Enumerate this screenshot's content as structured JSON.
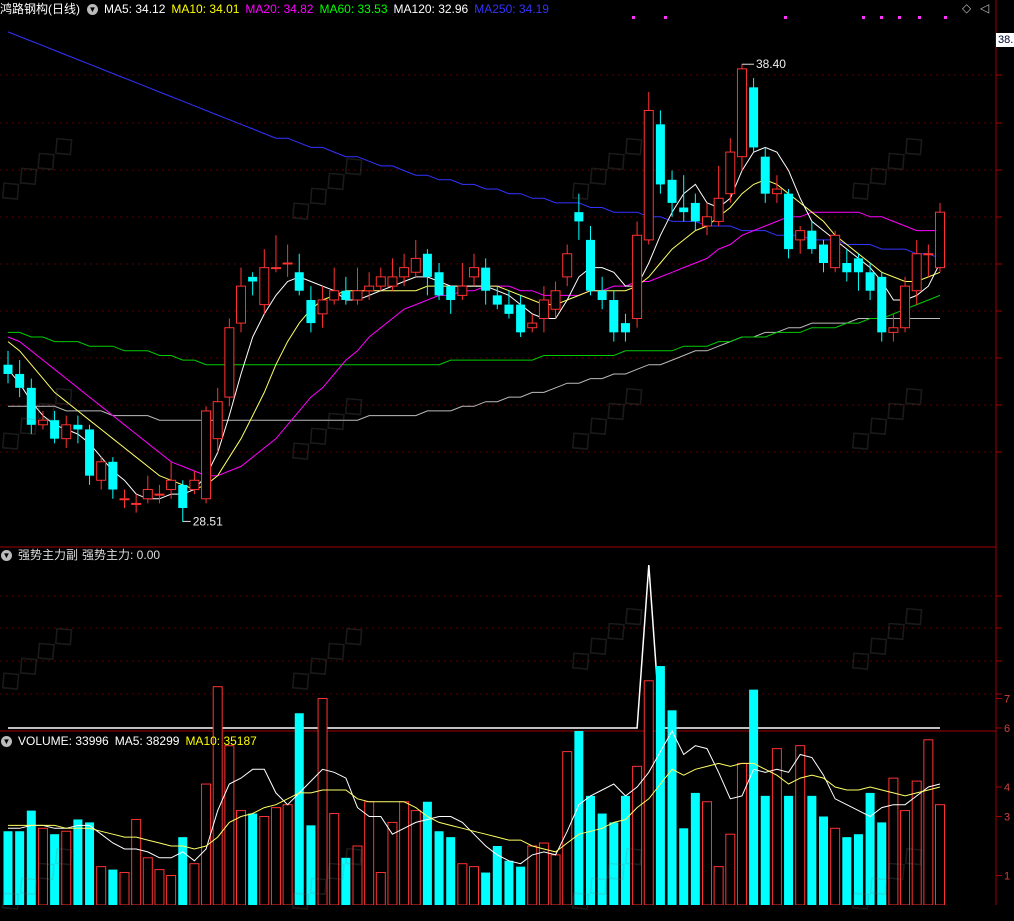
{
  "stock": {
    "name": "鸿路钢构(日线)",
    "indicators": [
      {
        "label": "MA5: 34.12",
        "color": "#ffffff"
      },
      {
        "label": "MA10: 34.01",
        "color": "#ffff00"
      },
      {
        "label": "MA20: 34.82",
        "color": "#ff00ff"
      },
      {
        "label": "MA60: 33.53",
        "color": "#00ff00"
      },
      {
        "label": "MA120: 32.96",
        "color": "#ffffff"
      },
      {
        "label": "MA250: 34.19",
        "color": "#3333ff"
      }
    ],
    "price_tag": "38.",
    "high_label": "38.40",
    "low_label": "28.51"
  },
  "indicator_panel": {
    "title": "强势主力副",
    "value_label": "强势主力: 0.00"
  },
  "volume_panel": {
    "items": [
      {
        "label": "VOLUME: 33996",
        "color": "#ffffff"
      },
      {
        "label": "MA5: 38299",
        "color": "#ffffff"
      },
      {
        "label": "MA10: 35187",
        "color": "#ffff00"
      }
    ],
    "axis_ticks": [
      "7",
      "6",
      "4",
      "3",
      "1"
    ]
  },
  "chart_data": {
    "type": "candlestick",
    "candles": [
      [
        31.9,
        31.7,
        32.2,
        31.5
      ],
      [
        31.7,
        31.4,
        32.0,
        31.2
      ],
      [
        31.4,
        30.6,
        31.6,
        30.4
      ],
      [
        30.6,
        30.7,
        30.9,
        30.5
      ],
      [
        30.7,
        30.3,
        30.9,
        30.2
      ],
      [
        30.3,
        30.6,
        30.8,
        30.1
      ],
      [
        30.6,
        30.5,
        30.8,
        30.2
      ],
      [
        30.5,
        29.5,
        30.6,
        29.3
      ],
      [
        29.4,
        29.8,
        29.9,
        29.2
      ],
      [
        29.8,
        29.2,
        29.9,
        29.0
      ],
      [
        29.0,
        29.0,
        29.2,
        28.8
      ],
      [
        28.9,
        28.9,
        29.1,
        28.7
      ],
      [
        29.0,
        29.2,
        29.5,
        28.9
      ],
      [
        29.1,
        29.1,
        29.3,
        28.9
      ],
      [
        29.2,
        29.4,
        29.8,
        29.0
      ],
      [
        29.3,
        28.8,
        29.4,
        28.5
      ],
      [
        29.2,
        29.4,
        29.6,
        29.1
      ],
      [
        29.0,
        30.9,
        31.0,
        28.9
      ],
      [
        30.3,
        31.1,
        31.4,
        30.0
      ],
      [
        31.2,
        32.7,
        32.9,
        31.0
      ],
      [
        32.8,
        33.6,
        34.0,
        32.6
      ],
      [
        33.8,
        33.7,
        33.9,
        33.4
      ],
      [
        33.2,
        34.0,
        34.4,
        33.0
      ],
      [
        34.0,
        34.0,
        34.7,
        33.9
      ],
      [
        34.1,
        34.1,
        34.5,
        33.8
      ],
      [
        33.9,
        33.5,
        34.3,
        33.4
      ],
      [
        33.3,
        32.8,
        33.6,
        32.6
      ],
      [
        33.0,
        33.3,
        33.6,
        32.7
      ],
      [
        33.3,
        33.5,
        34.0,
        33.2
      ],
      [
        33.5,
        33.3,
        33.8,
        33.2
      ],
      [
        33.3,
        33.5,
        34.0,
        33.2
      ],
      [
        33.5,
        33.6,
        33.9,
        33.3
      ],
      [
        33.6,
        33.8,
        34.0,
        33.5
      ],
      [
        33.6,
        33.8,
        34.2,
        33.5
      ],
      [
        33.8,
        34.0,
        34.3,
        33.6
      ],
      [
        33.9,
        34.2,
        34.6,
        33.8
      ],
      [
        34.3,
        33.8,
        34.4,
        33.4
      ],
      [
        33.9,
        33.4,
        34.1,
        33.3
      ],
      [
        33.6,
        33.3,
        33.6,
        33.0
      ],
      [
        33.4,
        33.6,
        34.1,
        33.3
      ],
      [
        33.8,
        34.0,
        34.3,
        33.6
      ],
      [
        34.0,
        33.5,
        34.2,
        33.2
      ],
      [
        33.4,
        33.2,
        33.6,
        33.1
      ],
      [
        33.2,
        33.0,
        33.5,
        32.9
      ],
      [
        33.2,
        32.6,
        33.4,
        32.5
      ],
      [
        32.7,
        32.8,
        33.0,
        32.6
      ],
      [
        32.9,
        33.3,
        33.6,
        32.6
      ],
      [
        33.1,
        33.5,
        33.7,
        32.9
      ],
      [
        33.8,
        34.3,
        34.5,
        33.6
      ],
      [
        35.2,
        35.0,
        35.6,
        34.6
      ],
      [
        34.6,
        33.5,
        34.9,
        33.4
      ],
      [
        33.5,
        33.3,
        33.8,
        33.1
      ],
      [
        33.3,
        32.6,
        33.5,
        32.4
      ],
      [
        32.8,
        32.6,
        33.0,
        32.4
      ],
      [
        32.9,
        34.7,
        35.0,
        32.7
      ],
      [
        34.6,
        37.4,
        37.8,
        34.5
      ],
      [
        37.1,
        35.8,
        37.4,
        35.6
      ],
      [
        35.9,
        35.4,
        36.1,
        35.1
      ],
      [
        35.3,
        35.2,
        36.0,
        35.0
      ],
      [
        35.4,
        35.0,
        35.6,
        34.8
      ],
      [
        34.9,
        35.1,
        35.4,
        34.7
      ],
      [
        35.0,
        35.5,
        36.2,
        34.9
      ],
      [
        35.6,
        36.5,
        36.8,
        35.4
      ],
      [
        36.4,
        38.3,
        38.4,
        36.1
      ],
      [
        37.9,
        36.6,
        38.1,
        36.5
      ],
      [
        36.4,
        35.6,
        36.6,
        35.4
      ],
      [
        35.6,
        35.7,
        36.0,
        35.4
      ],
      [
        35.6,
        34.4,
        35.7,
        34.2
      ],
      [
        34.6,
        34.8,
        34.9,
        34.3
      ],
      [
        34.8,
        34.4,
        35.0,
        34.3
      ],
      [
        34.5,
        34.1,
        34.6,
        33.9
      ],
      [
        34.0,
        34.7,
        34.8,
        33.9
      ],
      [
        34.1,
        33.9,
        34.4,
        33.7
      ],
      [
        34.2,
        33.9,
        34.3,
        33.5
      ],
      [
        33.9,
        33.5,
        34.1,
        33.3
      ],
      [
        33.8,
        32.6,
        33.9,
        32.4
      ],
      [
        32.6,
        32.7,
        33.0,
        32.4
      ],
      [
        32.7,
        33.6,
        33.8,
        32.6
      ],
      [
        33.5,
        34.3,
        34.6,
        33.2
      ],
      [
        34.3,
        34.3,
        34.5,
        33.8
      ],
      [
        34.0,
        35.2,
        35.4,
        33.9
      ]
    ],
    "ma5": [
      31.8,
      31.5,
      31.1,
      30.8,
      30.6,
      30.5,
      30.4,
      30.2,
      29.9,
      29.6,
      29.4,
      29.1,
      29.0,
      29.0,
      29.1,
      29.1,
      29.2,
      29.5,
      30.0,
      30.8,
      31.7,
      32.5,
      33.0,
      33.4,
      33.7,
      33.8,
      33.7,
      33.6,
      33.5,
      33.3,
      33.3,
      33.4,
      33.5,
      33.6,
      33.7,
      33.8,
      33.8,
      33.7,
      33.6,
      33.6,
      33.6,
      33.6,
      33.5,
      33.4,
      33.2,
      33.0,
      32.9,
      32.9,
      33.3,
      33.8,
      34.0,
      34.0,
      33.9,
      33.6,
      33.6,
      34.1,
      34.7,
      35.2,
      35.6,
      35.8,
      35.4,
      35.3,
      35.5,
      36.1,
      36.5,
      36.6,
      36.5,
      36.1,
      35.5,
      35.0,
      34.8,
      34.6,
      34.4,
      34.2,
      34.0,
      33.7,
      33.3,
      33.3,
      33.4,
      33.6,
      34.1
    ],
    "ma10": [
      32.4,
      32.2,
      31.9,
      31.6,
      31.3,
      31.1,
      30.9,
      30.7,
      30.5,
      30.3,
      30.1,
      29.9,
      29.7,
      29.5,
      29.4,
      29.3,
      29.2,
      29.3,
      29.5,
      29.9,
      30.3,
      30.8,
      31.3,
      31.9,
      32.4,
      32.8,
      33.1,
      33.3,
      33.4,
      33.5,
      33.5,
      33.5,
      33.5,
      33.5,
      33.5,
      33.5,
      33.6,
      33.6,
      33.6,
      33.6,
      33.6,
      33.6,
      33.6,
      33.5,
      33.4,
      33.3,
      33.2,
      33.2,
      33.3,
      33.4,
      33.5,
      33.5,
      33.5,
      33.5,
      33.6,
      33.8,
      34.1,
      34.4,
      34.6,
      34.8,
      34.9,
      35.1,
      35.3,
      35.6,
      35.8,
      35.9,
      35.8,
      35.6,
      35.4,
      35.2,
      35.0,
      34.7,
      34.5,
      34.3,
      34.1,
      33.9,
      33.8,
      33.7,
      33.7,
      33.8,
      33.9
    ],
    "ma20": [
      32.5,
      32.4,
      32.2,
      32.0,
      31.8,
      31.6,
      31.4,
      31.2,
      31.0,
      30.8,
      30.6,
      30.4,
      30.2,
      30.0,
      29.8,
      29.7,
      29.6,
      29.5,
      29.5,
      29.6,
      29.7,
      29.9,
      30.1,
      30.3,
      30.6,
      30.9,
      31.2,
      31.4,
      31.7,
      32.0,
      32.2,
      32.5,
      32.7,
      32.9,
      33.1,
      33.2,
      33.3,
      33.4,
      33.4,
      33.5,
      33.5,
      33.6,
      33.6,
      33.6,
      33.5,
      33.5,
      33.4,
      33.4,
      33.4,
      33.4,
      33.5,
      33.5,
      33.6,
      33.6,
      33.7,
      33.7,
      33.8,
      33.9,
      34.0,
      34.1,
      34.2,
      34.4,
      34.5,
      34.7,
      34.8,
      34.9,
      35.0,
      35.1,
      35.1,
      35.2,
      35.2,
      35.2,
      35.2,
      35.2,
      35.1,
      35.1,
      35.0,
      34.9,
      34.8,
      34.8,
      34.8
    ],
    "ma60": [
      32.6,
      32.6,
      32.5,
      32.5,
      32.4,
      32.4,
      32.4,
      32.3,
      32.3,
      32.3,
      32.2,
      32.2,
      32.2,
      32.1,
      32.1,
      32.0,
      32.0,
      31.9,
      31.9,
      31.9,
      31.9,
      31.9,
      31.9,
      31.9,
      31.9,
      31.9,
      31.9,
      31.9,
      31.9,
      31.9,
      31.9,
      31.9,
      31.9,
      31.9,
      31.9,
      31.9,
      31.9,
      31.9,
      32.0,
      32.0,
      32.0,
      32.0,
      32.0,
      32.0,
      32.0,
      32.0,
      32.1,
      32.1,
      32.1,
      32.1,
      32.1,
      32.1,
      32.1,
      32.2,
      32.2,
      32.2,
      32.2,
      32.2,
      32.3,
      32.3,
      32.3,
      32.4,
      32.4,
      32.5,
      32.5,
      32.5,
      32.6,
      32.6,
      32.6,
      32.7,
      32.7,
      32.7,
      32.8,
      32.8,
      32.9,
      32.9,
      33.0,
      33.1,
      33.2,
      33.3,
      33.4
    ],
    "ma120": [
      31.0,
      31.0,
      31.0,
      31.0,
      31.0,
      30.9,
      30.9,
      30.9,
      30.9,
      30.8,
      30.8,
      30.8,
      30.8,
      30.7,
      30.7,
      30.7,
      30.7,
      30.7,
      30.7,
      30.7,
      30.7,
      30.7,
      30.7,
      30.7,
      30.7,
      30.7,
      30.7,
      30.7,
      30.7,
      30.7,
      30.7,
      30.8,
      30.8,
      30.8,
      30.8,
      30.8,
      30.9,
      30.9,
      30.9,
      31.0,
      31.0,
      31.1,
      31.1,
      31.2,
      31.2,
      31.3,
      31.3,
      31.4,
      31.5,
      31.5,
      31.6,
      31.6,
      31.7,
      31.7,
      31.8,
      31.9,
      31.9,
      32.0,
      32.1,
      32.2,
      32.2,
      32.3,
      32.4,
      32.5,
      32.5,
      32.6,
      32.6,
      32.7,
      32.7,
      32.8,
      32.8,
      32.8,
      32.8,
      32.9,
      32.9,
      32.9,
      32.9,
      32.9,
      32.9,
      32.9,
      32.9
    ],
    "ma250": [
      39.1,
      39.0,
      38.9,
      38.8,
      38.7,
      38.6,
      38.5,
      38.4,
      38.3,
      38.2,
      38.1,
      38.0,
      37.9,
      37.8,
      37.7,
      37.6,
      37.5,
      37.4,
      37.3,
      37.2,
      37.1,
      37.0,
      36.9,
      36.8,
      36.8,
      36.7,
      36.6,
      36.6,
      36.5,
      36.4,
      36.4,
      36.3,
      36.2,
      36.2,
      36.1,
      36.0,
      36.0,
      35.9,
      35.9,
      35.8,
      35.8,
      35.7,
      35.7,
      35.6,
      35.6,
      35.5,
      35.5,
      35.4,
      35.4,
      35.4,
      35.3,
      35.3,
      35.2,
      35.2,
      35.2,
      35.1,
      35.1,
      35.0,
      35.0,
      35.0,
      34.9,
      34.9,
      34.9,
      34.8,
      34.8,
      34.8,
      34.7,
      34.7,
      34.7,
      34.6,
      34.6,
      34.6,
      34.5,
      34.5,
      34.5,
      34.4,
      34.4,
      34.4,
      34.3,
      34.3,
      34.2
    ],
    "indicator": [
      0,
      0,
      0,
      0,
      0,
      0,
      0,
      0,
      0,
      0,
      0,
      0,
      0,
      0,
      0,
      0,
      0,
      0,
      0,
      0,
      0,
      0,
      0,
      0,
      0,
      0,
      0,
      0,
      0,
      0,
      0,
      0,
      0,
      0,
      0,
      0,
      0,
      0,
      0,
      0,
      0,
      0,
      0,
      0,
      0,
      0,
      0,
      0,
      0,
      0,
      0,
      0,
      0,
      0,
      0,
      1,
      0,
      0,
      0,
      0,
      0,
      0,
      0,
      0,
      0,
      0,
      0,
      0,
      0,
      0,
      0,
      0,
      0,
      0,
      0,
      0,
      0,
      0,
      0,
      0,
      0
    ],
    "volume": [
      2.5,
      2.5,
      3.2,
      2.6,
      2.4,
      2.5,
      2.9,
      2.8,
      1.3,
      1.2,
      1.1,
      2.9,
      1.6,
      1.2,
      1.0,
      2.3,
      1.4,
      4.1,
      7.4,
      5.4,
      3.2,
      3.1,
      3.0,
      3.3,
      3.4,
      6.5,
      2.7,
      7.0,
      3.1,
      1.6,
      2.0,
      3.5,
      1.1,
      2.8,
      3.5,
      3.2,
      3.5,
      2.5,
      2.3,
      1.4,
      1.3,
      1.1,
      2.0,
      1.5,
      1.3,
      2.0,
      2.1,
      1.7,
      5.2,
      5.9,
      3.7,
      3.1,
      2.8,
      3.7,
      4.7,
      7.6,
      8.1,
      6.6,
      2.6,
      3.8,
      3.5,
      1.3,
      2.4,
      4.8,
      7.3,
      3.7,
      5.3,
      3.7,
      5.4,
      3.7,
      3.0,
      2.6,
      2.3,
      2.4,
      3.8,
      2.8,
      4.3,
      3.2,
      4.2,
      5.6,
      3.4
    ],
    "vol_ma5": [
      2.6,
      2.6,
      2.7,
      2.7,
      2.6,
      2.6,
      2.7,
      2.7,
      2.4,
      2.1,
      1.9,
      1.9,
      1.8,
      1.6,
      1.6,
      1.8,
      1.5,
      1.9,
      3.2,
      4.1,
      4.3,
      4.6,
      4.6,
      3.8,
      3.4,
      3.8,
      4.2,
      4.6,
      4.5,
      4.3,
      3.3,
      3.0,
      3.0,
      2.4,
      2.6,
      2.8,
      2.9,
      3.0,
      3.0,
      2.8,
      2.4,
      2.0,
      1.7,
      1.5,
      1.4,
      1.7,
      1.8,
      1.7,
      2.5,
      3.4,
      3.7,
      3.9,
      4.1,
      3.7,
      4.0,
      4.5,
      5.2,
      5.9,
      5.1,
      5.4,
      5.3,
      4.5,
      3.6,
      3.7,
      4.6,
      4.5,
      4.6,
      4.5,
      5.1,
      5.0,
      4.4,
      3.6,
      3.4,
      3.2,
      3.0,
      3.3,
      3.4,
      3.4,
      3.7,
      4.0,
      4.1
    ],
    "vol_ma10": [
      2.7,
      2.7,
      2.7,
      2.7,
      2.7,
      2.6,
      2.6,
      2.6,
      2.5,
      2.4,
      2.3,
      2.3,
      2.2,
      2.1,
      2.0,
      2.0,
      1.9,
      2.0,
      2.3,
      2.8,
      3.0,
      3.1,
      3.3,
      3.4,
      3.6,
      3.8,
      3.8,
      3.9,
      3.9,
      3.9,
      3.6,
      3.5,
      3.5,
      3.5,
      3.5,
      3.3,
      3.0,
      2.8,
      2.7,
      2.6,
      2.5,
      2.4,
      2.3,
      2.2,
      2.2,
      2.0,
      1.9,
      1.8,
      2.1,
      2.4,
      2.5,
      2.6,
      2.8,
      2.9,
      3.3,
      3.6,
      4.1,
      4.6,
      4.4,
      4.6,
      4.7,
      4.8,
      4.7,
      4.8,
      4.8,
      4.6,
      4.4,
      4.1,
      4.3,
      4.4,
      4.3,
      4.0,
      3.9,
      3.9,
      4.0,
      3.9,
      3.8,
      3.7,
      3.8,
      3.9,
      4.0
    ]
  }
}
